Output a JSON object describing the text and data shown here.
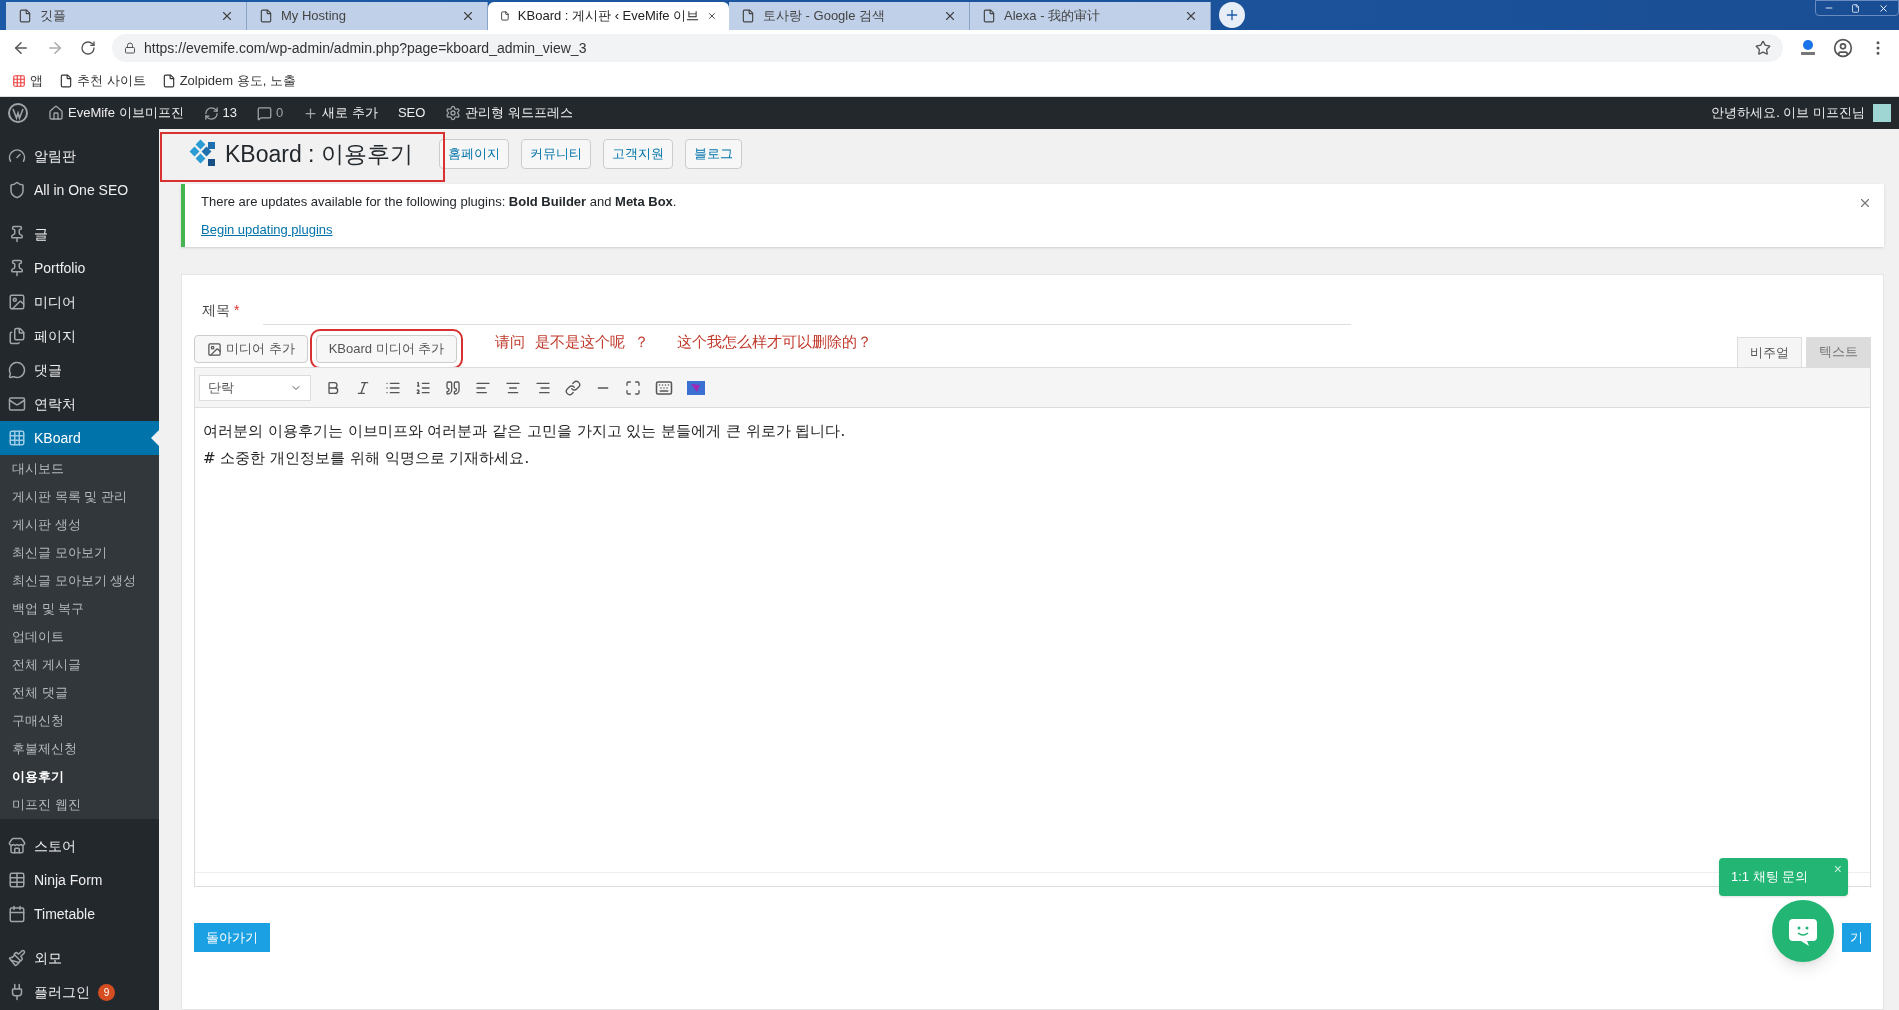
{
  "browser": {
    "tabs": [
      {
        "title": "깃플",
        "selected": false
      },
      {
        "title": "My Hosting",
        "selected": false
      },
      {
        "title": "KBoard : 게시판 ‹ EveMife 이브",
        "selected": true
      },
      {
        "title": "토사랑 - Google 검색",
        "selected": false
      },
      {
        "title": "Alexa - 我的审计",
        "selected": false
      }
    ],
    "url": "https://evemife.com/wp-admin/admin.php?page=kboard_admin_view_3",
    "bookmarks": [
      "앱",
      "추천 사이트",
      "Zolpidem 용도, 노출"
    ]
  },
  "admin_bar": {
    "site": "EveMife 이브미프진",
    "updates": "13",
    "comments": "0",
    "new": "새로 추가",
    "seo": "SEO",
    "managed": "관리형 워드프레스",
    "greeting": "안녕하세요. 이브 미프진님"
  },
  "sidebar": {
    "items": [
      {
        "label": "알림판",
        "kind": "main",
        "selected": false
      },
      {
        "label": "All in One SEO",
        "kind": "main",
        "selected": false
      },
      {
        "label": "글",
        "kind": "main",
        "selected": false
      },
      {
        "label": "Portfolio",
        "kind": "main",
        "selected": false
      },
      {
        "label": "미디어",
        "kind": "main",
        "selected": false
      },
      {
        "label": "페이지",
        "kind": "main",
        "selected": false
      },
      {
        "label": "댓글",
        "kind": "main",
        "selected": false
      },
      {
        "label": "연락처",
        "kind": "main",
        "selected": false
      },
      {
        "label": "KBoard",
        "kind": "main",
        "selected": true
      },
      {
        "label": "대시보드",
        "kind": "sub",
        "selected": false
      },
      {
        "label": "게시판 목록 및 관리",
        "kind": "sub",
        "selected": false
      },
      {
        "label": "게시판 생성",
        "kind": "sub",
        "selected": false
      },
      {
        "label": "최신글 모아보기",
        "kind": "sub",
        "selected": false
      },
      {
        "label": "최신글 모아보기 생성",
        "kind": "sub",
        "selected": false
      },
      {
        "label": "백업 및 복구",
        "kind": "sub",
        "selected": false
      },
      {
        "label": "업데이트",
        "kind": "sub",
        "selected": false
      },
      {
        "label": "전체 게시글",
        "kind": "sub",
        "selected": false
      },
      {
        "label": "전체 댓글",
        "kind": "sub",
        "selected": false
      },
      {
        "label": "구매신청",
        "kind": "sub",
        "selected": false
      },
      {
        "label": "후불제신청",
        "kind": "sub",
        "selected": false
      },
      {
        "label": "이용후기",
        "kind": "sub",
        "selected": true
      },
      {
        "label": "미프진 웹진",
        "kind": "sub",
        "selected": false
      },
      {
        "label": "스토어",
        "kind": "main",
        "selected": false
      },
      {
        "label": "Ninja Form",
        "kind": "main",
        "selected": false
      },
      {
        "label": "Timetable",
        "kind": "main",
        "selected": false
      },
      {
        "label": "외모",
        "kind": "main",
        "selected": false
      },
      {
        "label": "플러그인",
        "kind": "main",
        "selected": false,
        "badge": "9"
      }
    ]
  },
  "header": {
    "title": "KBoard : 이용후기",
    "links": [
      "홈페이지",
      "커뮤니티",
      "고객지원",
      "블로그"
    ]
  },
  "notice": {
    "text": "There are updates available for the following plugins: **Bold Builder** and **Meta Box**.",
    "link": "Begin updating plugins"
  },
  "form": {
    "title_label": "제목",
    "required": "*",
    "media_buttons": [
      "미디어 추가",
      "KBoard 미디어 추가"
    ],
    "annotations": [
      "请问  是不是这个呢  ？",
      "这个我怎么样才可以删除的？"
    ],
    "editor_tabs": [
      {
        "label": "비주얼",
        "selected": true
      },
      {
        "label": "텍스트",
        "selected": false
      }
    ],
    "format": "단락",
    "content": [
      "여러분의 이용후기는 이브미프와 여러분과 같은 고민을 가지고 있는 분들에게 큰 위로가 됩니다.",
      "# 소중한 개인정보를 위해 익명으로 기재하세요."
    ],
    "back_button": "돌아가기",
    "submit_button": "기"
  },
  "chat": {
    "label": "1:1 채팅 문의",
    "close": "×"
  }
}
